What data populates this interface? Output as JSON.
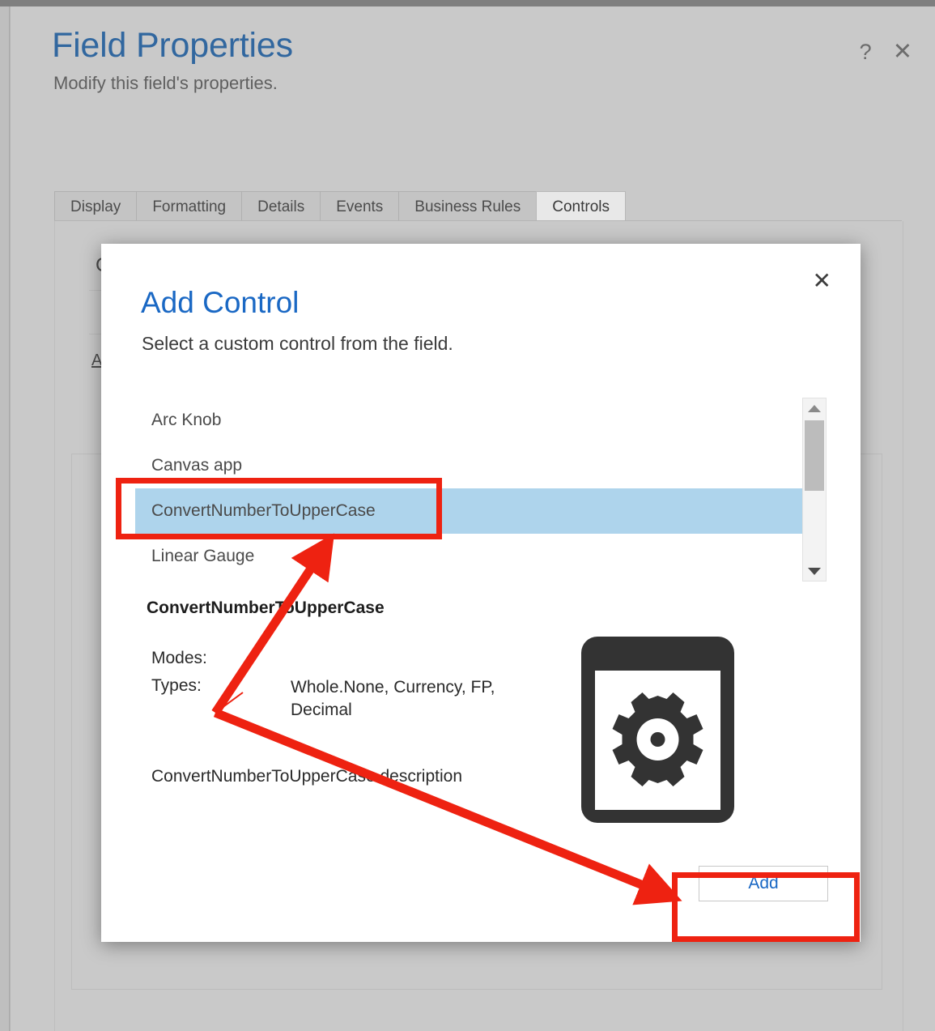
{
  "page": {
    "title": "Field Properties",
    "subtitle": "Modify this field's properties.",
    "help_icon": "?",
    "close_icon": "✕"
  },
  "tabs": [
    {
      "label": "Display",
      "active": false
    },
    {
      "label": "Formatting",
      "active": false
    },
    {
      "label": "Details",
      "active": false
    },
    {
      "label": "Events",
      "active": false
    },
    {
      "label": "Business Rules",
      "active": false
    },
    {
      "label": "Controls",
      "active": true
    }
  ],
  "background": {
    "section_title": "C",
    "link_label": "A"
  },
  "modal": {
    "close_icon": "✕",
    "title": "Add Control",
    "subtitle": "Select a custom control from the field.",
    "list": [
      {
        "label": "Arc Knob",
        "selected": false
      },
      {
        "label": "Canvas app",
        "selected": false
      },
      {
        "label": "ConvertNumberToUpperCase",
        "selected": true
      },
      {
        "label": "Linear Gauge",
        "selected": false
      }
    ],
    "scrollbar": {
      "up_arrow": "▲",
      "down_arrow": "▼"
    },
    "details": {
      "name": "ConvertNumberToUpperCase",
      "modes_label": "Modes:",
      "modes_value": "",
      "types_label": "Types:",
      "types_value": "Whole.None, Currency, FP, Decimal",
      "description": "ConvertNumberToUpperCase description",
      "preview_icon": "gear-in-frame-icon"
    },
    "footer": {
      "add_label": "Add"
    }
  },
  "annotations": {
    "highlight_color": "#ee2211",
    "boxes": [
      {
        "target": "ConvertNumberToUpperCase"
      },
      {
        "target": "Add"
      }
    ],
    "arrows": 2
  },
  "colors": {
    "accent_blue": "#1a68c4",
    "title_blue": "#31679f",
    "selection_blue": "#aed4ec",
    "page_background": "#c9c9c9",
    "modal_background": "#ffffff",
    "annotation_red": "#ee2211"
  }
}
